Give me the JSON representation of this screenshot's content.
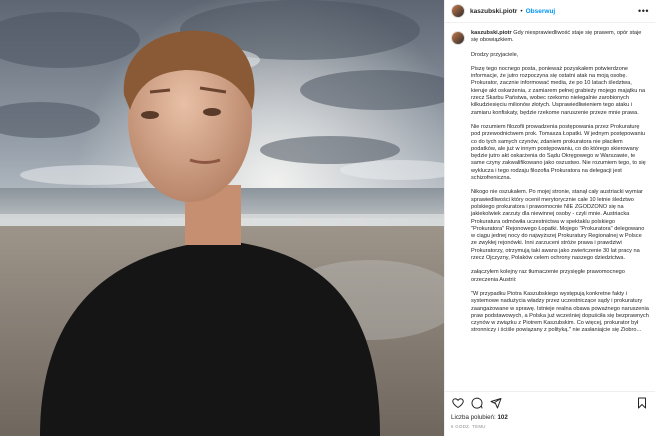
{
  "post": {
    "username": "kaszubski.piotr",
    "dot": "•",
    "follow_label": "Obserwuj",
    "more_label": "•••"
  },
  "caption": {
    "username": "kaszubski.piotr",
    "first_line": "Gdy niesprawiedliwość staje się prawem, opór staje się obowiązkiem.",
    "paragraphs": [
      "Drodzy przyjaciele,",
      "Piszę tego nocnego posta, ponieważ pozyskałem potwierdzone informacje, że jutro rozpoczyna się ostatni atak na moją osobę. Prokurator, zacznie informować media, że po 10 latach śledztwa, kieruje akt oskarżenia, z zamiarem pełnej grabieży mojego majątku na rzecz Skarbu Państwa, wobec rzekomo nielegalnie zarobionych kilkudziesięciu milionów złotych. Usprawiedliwieniem tego ataku i zamiaru konfiskaty, będzie rzekome naruszenie przeze mnie prawa.",
      "Nie rozumiem filozofii prowadzenia postępowania przez Prokuraturę pod przewodnictwem prok. Tomasza Łopatki. W jednym postępowaniu co do tych samych czynów, zdaniem prokuratora nie płaciłem podatków, ale już w innym postępowaniu, co do którego skierowany będzie jutro akt oskarżenia do Sądu Okręgowego w Warszawie, te same czyny zakwalifikowano jako oszustwo. Nie rozumiem tego, to się wyklucza i tego rodzaju filozofia Prokuratora na delegacji jest schizofreniczna.",
      "Nikogo nie oszukałem. Po mojej stronie, stanął cały austriacki wymiar sprawiedliwości który ocenił merytorycznie całe 10 letnie śledztwo polskiego prokuratora i prawomocnie NIE ZGODZONO się na jakiekolwiek zarzuty dla niewinnej osoby - czyli mnie. Austriacka Prokuratura odmówiła uczestnictwa w spektaklu polskiego \"Prokuratora\" Rejonowego Łopatki. Mojego \"Prokuratora\" delegowano w ciągu jednej nocy do najwyższej Prokuratury Regionalnej w Polsce ze zwykłej rejonówki. Inni zarzuceni stróże prawa i prawdziwi Prokuratorzy, otrzymują taki awans jako zwieńczenie 30 lat pracy na rzecz Ojczyzny, Polaków celem ochrony naszego dziedzictwa.",
      "załączyłem kolejny raz tłumaczenie przysięgłe prawomocnego orzeczenia Austrii:",
      "\"W przypadku Piotra Kaszubskiego występują konkretne fakty i systemowe nadużycia władzy przez uczestniczące sądy i prokuratury zaangażowane w sprawę. Istnieje realna obawa poważnego naruszenia praw podstawowych, a Polska już wcześniej dopuściła się bezprawnych czynów w związku z Piotrem Kaszubskim. Co więcej, prokurator był stronniczy i ściśle powiązany z polityką.\" nie zasłaniajcie się Ziobro..."
    ]
  },
  "icons": {
    "like": "heart-icon",
    "comment": "comment-icon",
    "share": "share-icon",
    "save": "bookmark-icon"
  },
  "likes": {
    "label": "Liczba polubień:",
    "count": "102"
  },
  "date": "6 GODZ. TEMU",
  "colors": {
    "accent": "#0095f6",
    "text": "#262626",
    "muted": "#8e8e8e"
  }
}
